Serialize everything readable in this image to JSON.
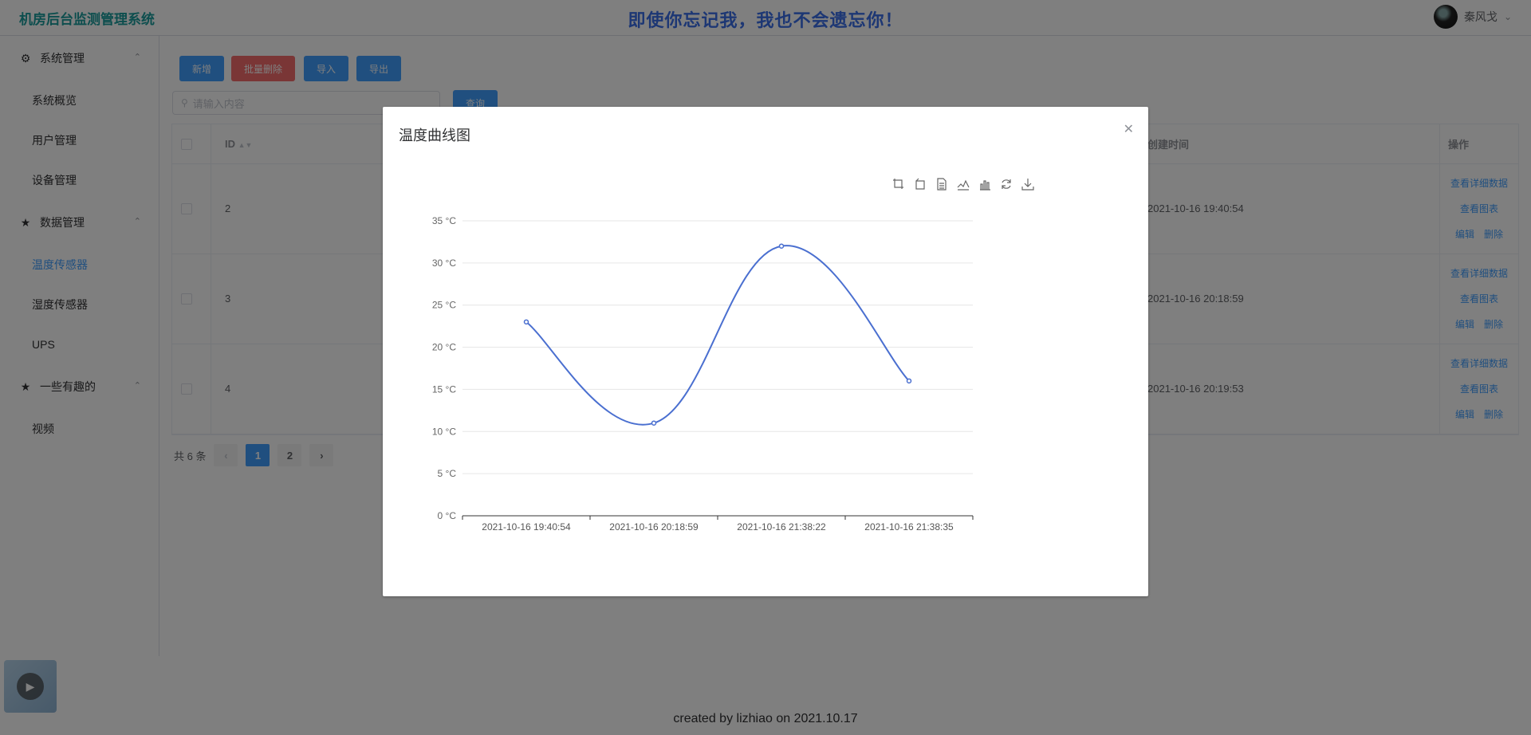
{
  "header": {
    "brand": "机房后台监测管理系统",
    "slogan": "即使你忘记我，我也不会遗忘你！",
    "username": "秦风戈"
  },
  "sidebar": {
    "groups": [
      {
        "label": "系统管理",
        "icon": "gear-icon",
        "items": [
          "系统概览",
          "用户管理",
          "设备管理"
        ]
      },
      {
        "label": "数据管理",
        "icon": "star-icon",
        "items": [
          "温度传感器",
          "湿度传感器",
          "UPS"
        ]
      },
      {
        "label": "一些有趣的",
        "icon": "star-icon",
        "items": [
          "视频"
        ]
      }
    ],
    "active_item": "温度传感器"
  },
  "toolbar": {
    "add": "新增",
    "batch_delete": "批量删除",
    "import": "导入",
    "export": "导出",
    "search_placeholder": "请输入内容",
    "query": "查询"
  },
  "table": {
    "headers": {
      "id": "ID",
      "created_time": "创建时间",
      "ops": "操作"
    },
    "rows": [
      {
        "id": "2",
        "time": "2021-10-16 19:40:54"
      },
      {
        "id": "3",
        "time": "2021-10-16 20:18:59"
      },
      {
        "id": "4",
        "time": "2021-10-16 20:19:53"
      }
    ],
    "op_labels": {
      "detail": "查看详细数据",
      "chart": "查看图表",
      "edit": "编辑",
      "delete": "删除"
    }
  },
  "pagination": {
    "total": "共 6 条",
    "pages": [
      "1",
      "2"
    ],
    "current": "1"
  },
  "footer": "created by lizhiao on 2021.10.17",
  "dialog": {
    "title": "温度曲线图",
    "toolbox": [
      "zoom-icon",
      "zoom-reset-icon",
      "data-view-icon",
      "line-chart-icon",
      "bar-chart-icon",
      "restore-icon",
      "download-icon"
    ]
  },
  "chart_data": {
    "type": "line",
    "categories": [
      "2021-10-16 19:40:54",
      "2021-10-16 20:18:59",
      "2021-10-16 21:38:22",
      "2021-10-16 21:38:35"
    ],
    "series": [
      {
        "values": [
          23,
          11,
          32,
          16
        ]
      }
    ],
    "ylim": [
      0,
      35
    ],
    "yticks": [
      0,
      5,
      10,
      15,
      20,
      25,
      30,
      35
    ],
    "y_unit": " °C",
    "smooth": true,
    "color": "#4a6fd0",
    "grid": true
  },
  "colors": {
    "primary": "#409eff",
    "danger": "#f56c6c",
    "brand": "#1a9c9c",
    "slogan": "#3a6ee8"
  }
}
